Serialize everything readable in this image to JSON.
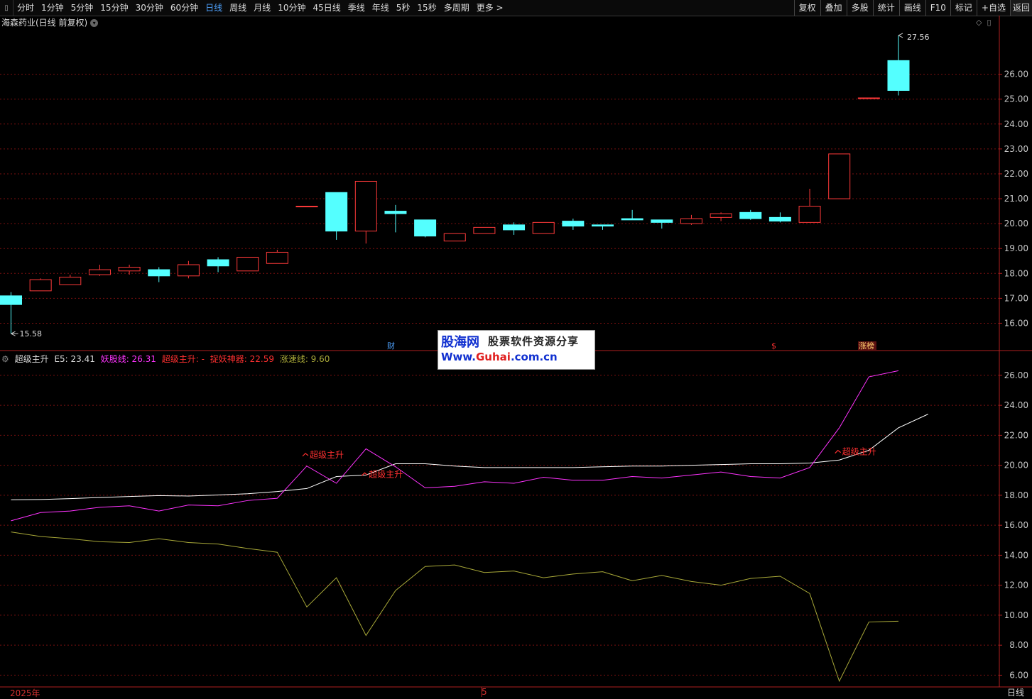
{
  "toolbar": {
    "periods": [
      "分时",
      "1分钟",
      "5分钟",
      "15分钟",
      "30分钟",
      "60分钟",
      "日线",
      "周线",
      "月线",
      "10分钟",
      "45日线",
      "季线",
      "年线",
      "5秒",
      "15秒",
      "多周期",
      "更多 >"
    ],
    "active": "日线",
    "right_buttons": [
      "复权",
      "叠加",
      "多股",
      "统计",
      "画线",
      "F10",
      "标记",
      "+自选",
      "返回"
    ]
  },
  "chart": {
    "title": "海森药业(日线 前复权)",
    "high_label": "27.56",
    "low_label": "15.58",
    "markers": {
      "cai": "财",
      "dollar": "$",
      "zhangbang": "涨榜"
    },
    "price_ticks": [
      "26.00",
      "25.00",
      "24.00",
      "23.00",
      "22.00",
      "21.00",
      "20.00",
      "19.00",
      "18.00",
      "17.00",
      "16.00"
    ],
    "colors": {
      "up": "#ff3a3a",
      "down": "#54ffff",
      "grid": "#7a1010",
      "axis": "#b02020"
    }
  },
  "indicator": {
    "name": "超级主升",
    "e5_label": "E5: 23.41",
    "yaogu_label": "妖股线: 26.31",
    "chaoji_label": "超级主升: -",
    "tiyao_label": "捉妖神器: 22.59",
    "zhangsu_label": "涨速线: 9.60",
    "signal_text": "超级主升",
    "ticks": [
      "26.00",
      "24.00",
      "22.00",
      "20.00",
      "18.00",
      "16.00",
      "14.00",
      "12.00",
      "10.00",
      "8.00",
      "6.00"
    ],
    "colors": {
      "e5": "#ffffff",
      "yaogu": "#ff33ff",
      "tiyao": "#ff3030",
      "zhangsu": "#a8a838"
    }
  },
  "footer": {
    "date1": "2025年",
    "date2": "5",
    "period": "日线"
  },
  "watermark": {
    "line1": "股海网",
    "line1b": "股票软件资源分享",
    "line2a": "Www.",
    "line2b": "Guhai",
    "line2c": ".com.cn"
  },
  "chart_data": {
    "type": "candlestick",
    "candles": [
      {
        "o": 17.1,
        "h": 17.25,
        "l": 15.58,
        "c": 16.75
      },
      {
        "o": 17.3,
        "h": 17.8,
        "l": 17.3,
        "c": 17.75
      },
      {
        "o": 17.55,
        "h": 17.95,
        "l": 17.55,
        "c": 17.85
      },
      {
        "o": 17.95,
        "h": 18.35,
        "l": 17.9,
        "c": 18.15
      },
      {
        "o": 18.1,
        "h": 18.35,
        "l": 17.95,
        "c": 18.25
      },
      {
        "o": 18.15,
        "h": 18.25,
        "l": 17.65,
        "c": 17.9
      },
      {
        "o": 17.9,
        "h": 18.5,
        "l": 17.8,
        "c": 18.35
      },
      {
        "o": 18.55,
        "h": 18.65,
        "l": 18.05,
        "c": 18.3
      },
      {
        "o": 18.1,
        "h": 18.65,
        "l": 18.1,
        "c": 18.65
      },
      {
        "o": 18.4,
        "h": 18.95,
        "l": 18.4,
        "c": 18.85
      },
      {
        "o": 20.7,
        "h": 20.7,
        "l": 20.7,
        "c": 20.7
      },
      {
        "o": 21.25,
        "h": 21.25,
        "l": 19.35,
        "c": 19.7
      },
      {
        "o": 19.7,
        "h": 21.7,
        "l": 19.2,
        "c": 21.7
      },
      {
        "o": 20.5,
        "h": 20.75,
        "l": 19.65,
        "c": 20.4
      },
      {
        "o": 20.15,
        "h": 20.15,
        "l": 19.45,
        "c": 19.5
      },
      {
        "o": 19.3,
        "h": 19.6,
        "l": 19.3,
        "c": 19.6
      },
      {
        "o": 19.6,
        "h": 19.85,
        "l": 19.6,
        "c": 19.85
      },
      {
        "o": 19.95,
        "h": 20.05,
        "l": 19.55,
        "c": 19.75
      },
      {
        "o": 19.6,
        "h": 20.05,
        "l": 19.6,
        "c": 20.05
      },
      {
        "o": 20.1,
        "h": 20.2,
        "l": 19.75,
        "c": 19.9
      },
      {
        "o": 19.95,
        "h": 19.95,
        "l": 19.75,
        "c": 19.9
      },
      {
        "o": 20.2,
        "h": 20.55,
        "l": 20.15,
        "c": 20.15
      },
      {
        "o": 20.15,
        "h": 20.15,
        "l": 19.8,
        "c": 20.05
      },
      {
        "o": 20.0,
        "h": 20.35,
        "l": 19.95,
        "c": 20.2
      },
      {
        "o": 20.25,
        "h": 20.45,
        "l": 20.1,
        "c": 20.4
      },
      {
        "o": 20.45,
        "h": 20.55,
        "l": 20.15,
        "c": 20.2
      },
      {
        "o": 20.25,
        "h": 20.45,
        "l": 20.05,
        "c": 20.1
      },
      {
        "o": 20.05,
        "h": 21.4,
        "l": 20.05,
        "c": 20.7
      },
      {
        "o": 21.0,
        "h": 22.8,
        "l": 21.0,
        "c": 22.8
      },
      {
        "o": 25.05,
        "h": 25.05,
        "l": 25.05,
        "c": 25.05
      },
      {
        "o": 26.55,
        "h": 27.56,
        "l": 25.15,
        "c": 25.35
      }
    ],
    "series": [
      {
        "name": "E5",
        "values": [
          17.7,
          17.72,
          17.78,
          17.85,
          17.92,
          17.98,
          17.95,
          18.02,
          18.1,
          18.25,
          18.45,
          19.25,
          19.35,
          20.1,
          20.1,
          19.95,
          19.85,
          19.85,
          19.85,
          19.85,
          19.9,
          19.95,
          19.95,
          20.0,
          20.05,
          20.1,
          20.1,
          20.15,
          20.35,
          21.0,
          22.5,
          23.41
        ]
      },
      {
        "name": "妖股线",
        "values": [
          16.3,
          16.85,
          16.95,
          17.2,
          17.3,
          16.95,
          17.35,
          17.3,
          17.65,
          17.8,
          19.95,
          18.8,
          21.1,
          19.9,
          18.5,
          18.6,
          18.9,
          18.8,
          19.2,
          19.0,
          19.0,
          19.25,
          19.15,
          19.35,
          19.55,
          19.25,
          19.15,
          19.85,
          22.5,
          25.9,
          26.31
        ]
      },
      {
        "name": "涨速线",
        "values": [
          15.55,
          15.25,
          15.1,
          14.9,
          14.85,
          15.1,
          14.85,
          14.75,
          14.45,
          14.2,
          10.55,
          12.5,
          8.65,
          11.65,
          13.25,
          13.35,
          12.85,
          12.95,
          12.5,
          12.75,
          12.9,
          12.3,
          12.65,
          12.25,
          12.0,
          12.45,
          12.6,
          11.45,
          5.6,
          9.55,
          9.6
        ]
      }
    ],
    "signals": [
      {
        "index": 10,
        "value": 20.7
      },
      {
        "index": 12,
        "value": 19.4
      },
      {
        "index": 28,
        "value": 20.9
      }
    ],
    "ylim_price": [
      15.3,
      27.7
    ],
    "ylim_indicator": [
      5.5,
      26.8
    ]
  }
}
